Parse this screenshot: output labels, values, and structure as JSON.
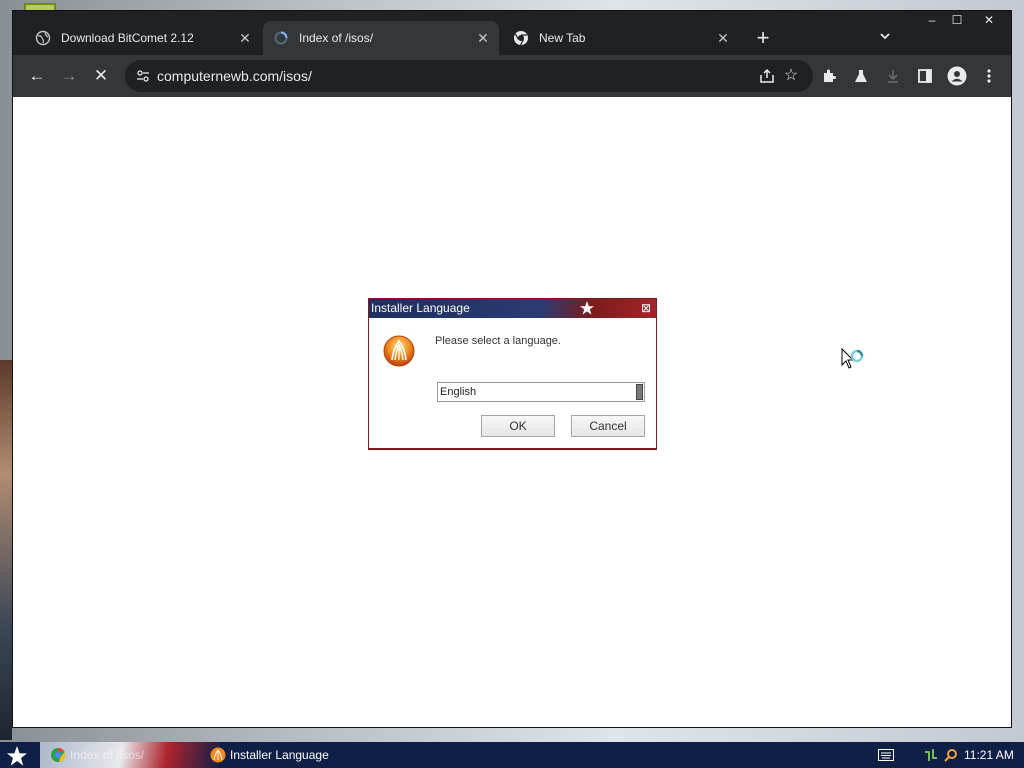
{
  "browser": {
    "tabs": [
      {
        "title": "Download BitComet 2.12",
        "active": false,
        "icon": "globe-icon"
      },
      {
        "title": "Index of /isos/",
        "active": true,
        "icon": "loading-icon"
      },
      {
        "title": "New Tab",
        "active": false,
        "icon": "chrome-icon"
      }
    ],
    "close_glyph": "✕",
    "new_tab_glyph": "+",
    "tab_list_glyph": "⌄",
    "window_controls": {
      "minimize": "–",
      "maximize": "☐",
      "close": "✕"
    },
    "toolbar": {
      "back_glyph": "←",
      "forward_glyph": "→",
      "stop_glyph": "✕",
      "url": "computernewb.com/isos/",
      "star_glyph": "☆"
    }
  },
  "dialog": {
    "title": "Installer Language",
    "close_glyph": "⊠",
    "message": "Please select a language.",
    "language_value": "English",
    "ok_label": "OK",
    "cancel_label": "Cancel"
  },
  "taskbar": {
    "items": [
      {
        "label": "Index of /isos/"
      },
      {
        "label": "Installer Language"
      }
    ],
    "clock": "11:21 AM"
  },
  "colors": {
    "browser_frame": "#202124",
    "toolbar": "#35363a",
    "dialog_border": "#7e1b1b",
    "taskbar": "#0f1f45"
  }
}
